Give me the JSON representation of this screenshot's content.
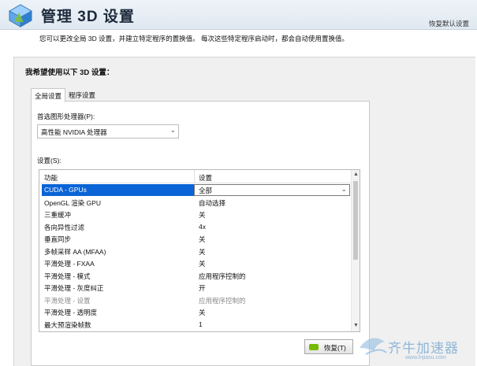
{
  "header": {
    "title": "管理 3D 设置",
    "restore_defaults": "恢复默认设置"
  },
  "description": "您可以更改全局 3D 设置，并建立特定程序的置换值。 每次这些特定程序启动时，都会自动使用置换值。",
  "section_title": "我希望使用以下 3D 设置：",
  "tabs": [
    {
      "label": "全局设置",
      "active": true
    },
    {
      "label": "程序设置",
      "active": false
    }
  ],
  "preferred_gpu": {
    "label": "首选图形处理器(P):",
    "value": "高性能 NVIDIA 处理器"
  },
  "settings": {
    "label": "设置(S):",
    "columns": [
      "功能",
      "设置"
    ],
    "rows": [
      {
        "feature": "CUDA - GPUs",
        "value": "全部",
        "selected": true
      },
      {
        "feature": "OpenGL 渲染 GPU",
        "value": "自动选择"
      },
      {
        "feature": "三重缓冲",
        "value": "关"
      },
      {
        "feature": "各向异性过滤",
        "value": "4x"
      },
      {
        "feature": "垂直同步",
        "value": "关"
      },
      {
        "feature": "多帧采样 AA (MFAA)",
        "value": "关"
      },
      {
        "feature": "平滑处理 - FXAA",
        "value": "关"
      },
      {
        "feature": "平滑处理 - 模式",
        "value": "应用程序控制的"
      },
      {
        "feature": "平滑处理 - 灰度纠正",
        "value": "开"
      },
      {
        "feature": "平滑处理 - 设置",
        "value": "应用程序控制的",
        "disabled": true
      },
      {
        "feature": "平滑处理 - 透明度",
        "value": "关"
      },
      {
        "feature": "最大预渲染帧数",
        "value": "1"
      }
    ]
  },
  "restore_button": "恢复(T)",
  "watermark": {
    "text": "齐牛加速器",
    "url": "www.lnjiasu.com"
  },
  "colors": {
    "selection": "#0a64d6",
    "nvidia_green": "#77b900"
  }
}
